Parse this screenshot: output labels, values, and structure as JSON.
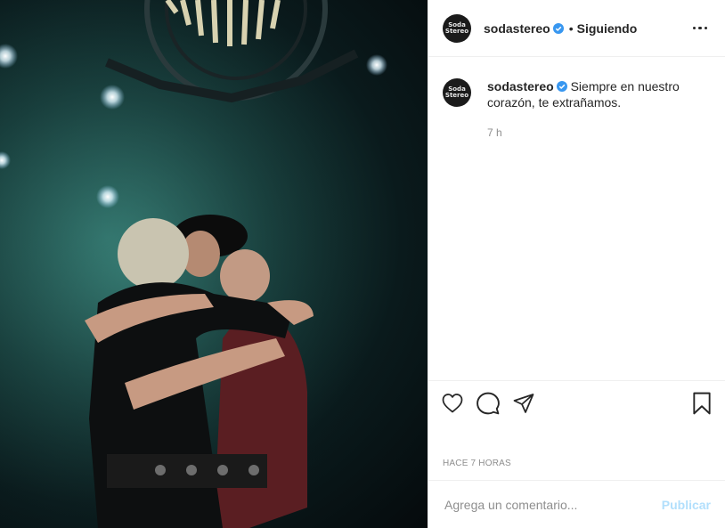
{
  "post": {
    "username": "sodastereo",
    "follow_status": "Siguiendo",
    "separator": "•",
    "avatar_text": "Soda Stereo",
    "caption": "Siempre en nuestro corazón, te extrañamos.",
    "caption_time": "7 h",
    "post_time": "HACE 7 HORAS"
  },
  "comment_box": {
    "placeholder": "Agrega un comentario...",
    "submit_label": "Publicar"
  },
  "icons": {
    "verified": "verified-badge-icon",
    "like": "heart-icon",
    "comment": "comment-icon",
    "share": "share-icon",
    "save": "bookmark-icon",
    "more": "more-options-icon"
  },
  "colors": {
    "verified": "#3897f0",
    "publish": "#b2dffc",
    "text": "#262626",
    "muted": "#8e8e8e"
  }
}
